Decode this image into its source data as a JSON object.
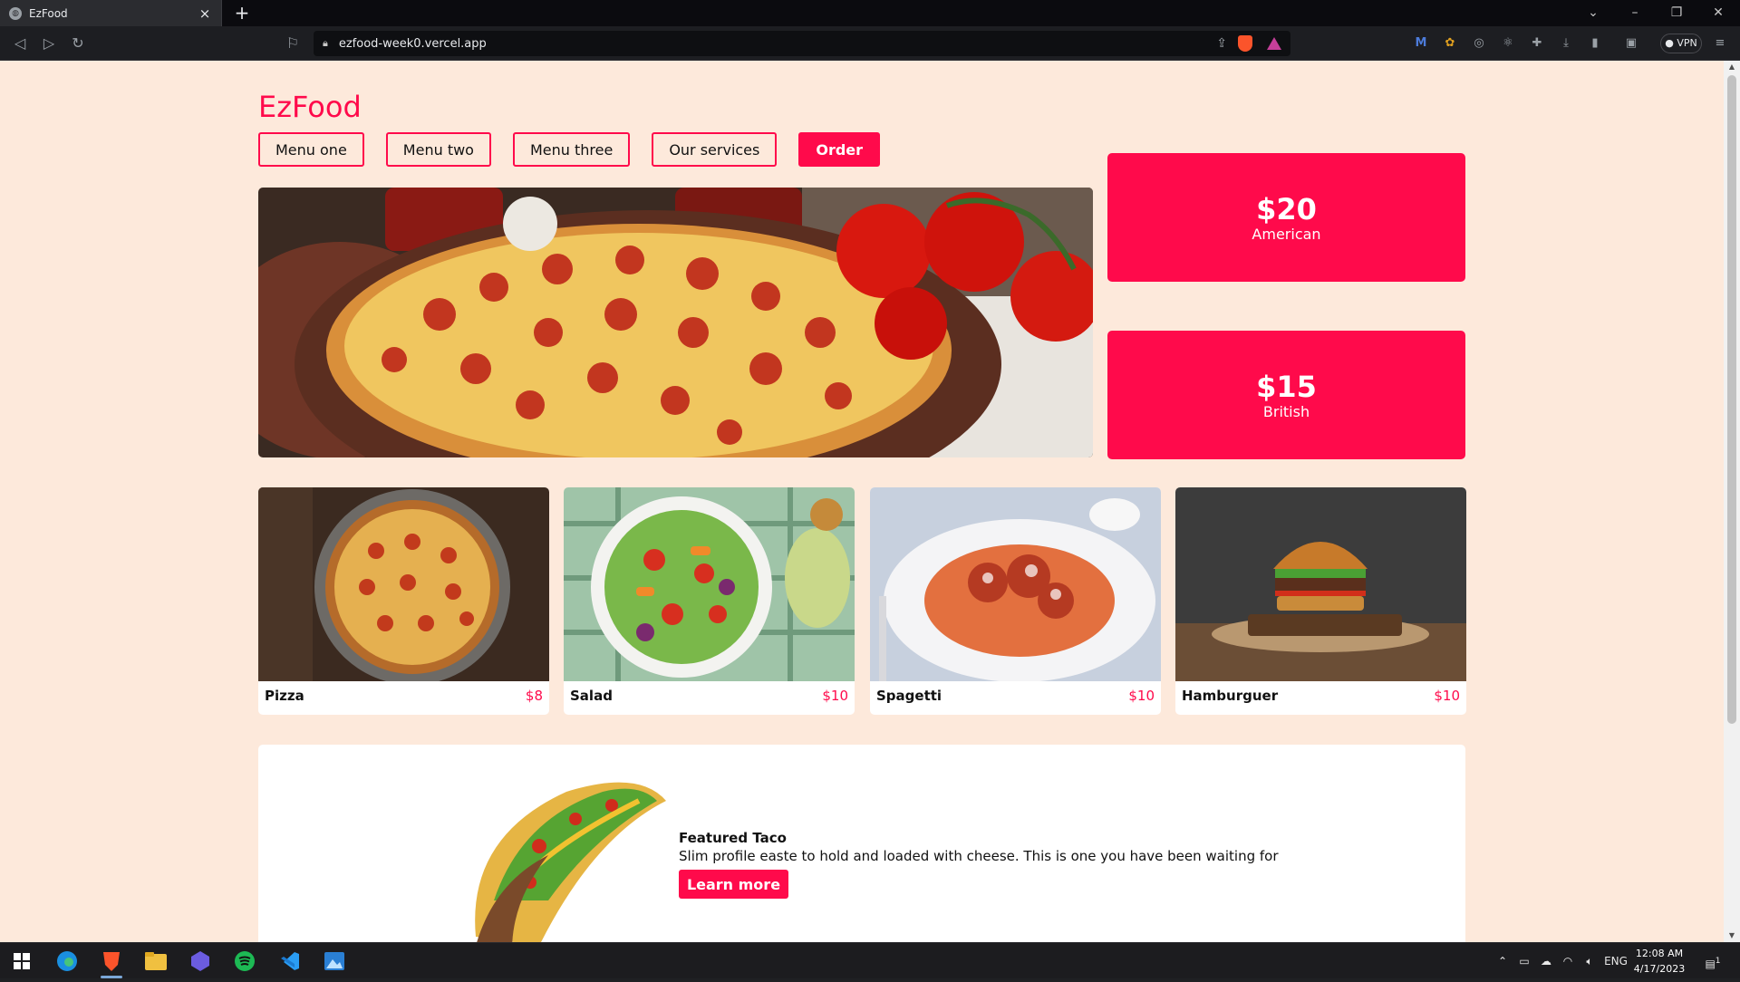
{
  "browser": {
    "tab_title": "EzFood",
    "new_tab": "+",
    "url": "ezfood-week0.vercel.app",
    "vpn": "VPN"
  },
  "site": {
    "brand": "EzFood",
    "nav": [
      "Menu one",
      "Menu two",
      "Menu three",
      "Our services"
    ],
    "order_label": "Order",
    "promos": [
      {
        "price": "$20",
        "cuisine": "American"
      },
      {
        "price": "$15",
        "cuisine": "British"
      }
    ],
    "items": [
      {
        "name": "Pizza",
        "price": "$8"
      },
      {
        "name": "Salad",
        "price": "$10"
      },
      {
        "name": "Spagetti",
        "price": "$10"
      },
      {
        "name": "Hamburguer",
        "price": "$10"
      }
    ],
    "featured": {
      "title": "Featured Taco",
      "description": "Slim profile easte to hold and loaded with cheese. This is one you have been waiting for",
      "button": "Learn more"
    }
  },
  "taskbar": {
    "language": "ENG",
    "time": "12:08 AM",
    "date": "4/17/2023",
    "notification_count": "1"
  },
  "colors": {
    "accent": "#ff0a4b",
    "page_bg": "#fde9db"
  }
}
